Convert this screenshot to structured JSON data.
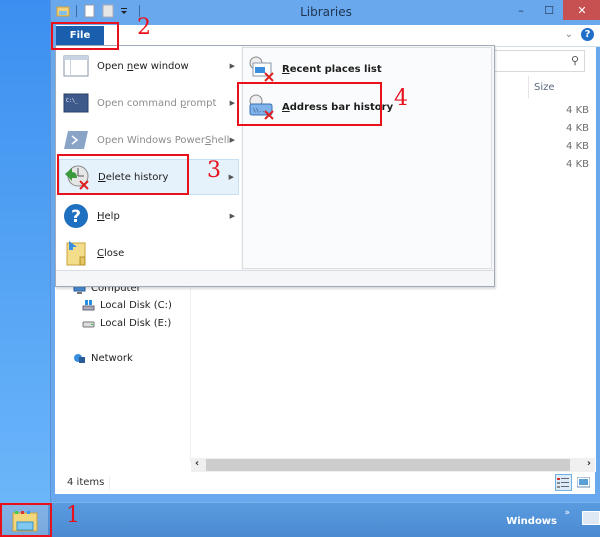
{
  "window": {
    "title": "Libraries",
    "controls": {
      "minimize": "–",
      "maximize": "☐",
      "close": "✕"
    }
  },
  "ribbon": {
    "file_tab": "File",
    "collapse_icon": "chevron-down-icon",
    "help_icon": "?"
  },
  "file_menu": {
    "items": [
      {
        "label_pre": "Open ",
        "label_key": "n",
        "label_post": "ew window",
        "icon": "window-icon",
        "disabled": false,
        "submenu": true
      },
      {
        "label_pre": "Open command ",
        "label_key": "p",
        "label_post": "rompt",
        "icon": "command-prompt-icon",
        "disabled": true,
        "submenu": true
      },
      {
        "label_pre": "Open Windows Power",
        "label_key": "S",
        "label_post": "hell",
        "icon": "powershell-icon",
        "disabled": true,
        "submenu": true
      },
      {
        "label_pre": "",
        "label_key": "D",
        "label_post": "elete history",
        "icon": "delete-history-icon",
        "disabled": false,
        "submenu": true
      },
      {
        "label_pre": "",
        "label_key": "H",
        "label_post": "elp",
        "icon": "help-icon",
        "disabled": false,
        "submenu": true
      },
      {
        "label_pre": "",
        "label_key": "C",
        "label_post": "lose",
        "icon": "close-folder-icon",
        "disabled": false,
        "submenu": false
      }
    ],
    "submenu": [
      {
        "label_key": "R",
        "label_post": "ecent places list",
        "icon": "recent-places-icon"
      },
      {
        "label_key": "A",
        "label_post": "ddress bar history",
        "icon": "address-bar-history-icon"
      }
    ]
  },
  "file_list": {
    "columns": {
      "size": "Size"
    },
    "sizes": [
      "4 KB",
      "4 KB",
      "4 KB",
      "4 KB"
    ]
  },
  "nav_pane": {
    "items": [
      {
        "label": "Computer",
        "icon": "computer-icon"
      },
      {
        "label": "Local Disk (C:)",
        "icon": "windows-drive-icon"
      },
      {
        "label": "Local Disk (E:)",
        "icon": "drive-icon"
      },
      {
        "label": "Network",
        "icon": "network-icon"
      }
    ]
  },
  "status_bar": {
    "item_count": "4 items"
  },
  "taskbar": {
    "toolbar_label": "Windows",
    "overflow": "»"
  },
  "annotations": {
    "step1": "1",
    "step2": "2",
    "step3": "3",
    "step4": "4"
  },
  "colors": {
    "accent": "#1a5fad",
    "annotation": "#e8101a",
    "close": "#c75050"
  }
}
